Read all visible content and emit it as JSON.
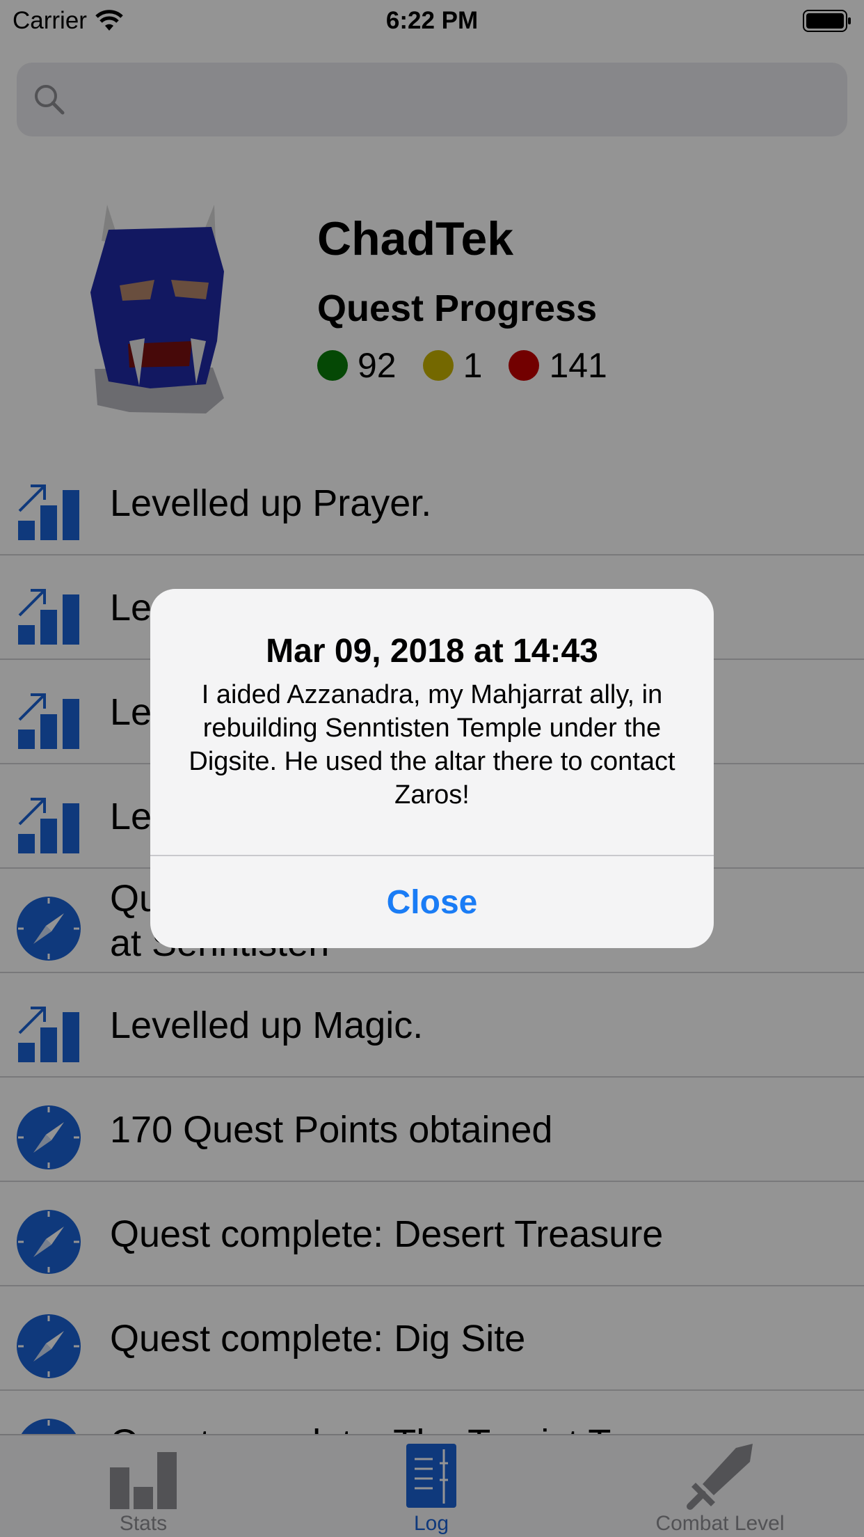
{
  "status_bar": {
    "carrier": "Carrier",
    "time": "6:22 PM"
  },
  "search": {
    "placeholder": ""
  },
  "profile": {
    "name": "ChadTek",
    "quest_title": "Quest Progress",
    "quest_counts": [
      {
        "value": "92",
        "color": "#0a7d0a"
      },
      {
        "value": "1",
        "color": "#c9b400"
      },
      {
        "value": "141",
        "color": "#c40000"
      }
    ]
  },
  "log": [
    {
      "icon": "level-up-icon",
      "text": "Levelled up Prayer."
    },
    {
      "icon": "level-up-icon",
      "text": "Le"
    },
    {
      "icon": "level-up-icon",
      "text": "Le"
    },
    {
      "icon": "level-up-icon",
      "text": "Le"
    },
    {
      "icon": "compass-icon",
      "text": "Qu",
      "text2": "at Senntisten"
    },
    {
      "icon": "level-up-icon",
      "text": "Levelled up Magic."
    },
    {
      "icon": "compass-icon",
      "text": "170 Quest Points obtained"
    },
    {
      "icon": "compass-icon",
      "text": "Quest complete: Desert Treasure"
    },
    {
      "icon": "compass-icon",
      "text": "Quest complete: Dig Site"
    },
    {
      "icon": "compass-icon",
      "text": "Quest complete: The Tourist Trap"
    }
  ],
  "tabs": [
    {
      "label": "Stats",
      "icon": "bar-chart-icon",
      "active": false
    },
    {
      "label": "Log",
      "icon": "book-icon",
      "active": true
    },
    {
      "label": "Combat Level",
      "icon": "sword-icon",
      "active": false
    }
  ],
  "alert": {
    "title": "Mar 09, 2018 at 14:43",
    "message": "I aided Azzanadra, my Mahjarrat ally, in rebuilding Senntisten Temple under the Digsite. He used the altar there to contact Zaros!",
    "button": "Close"
  },
  "colors": {
    "accent": "#1a62d6",
    "alert_button": "#1a7cf5"
  }
}
